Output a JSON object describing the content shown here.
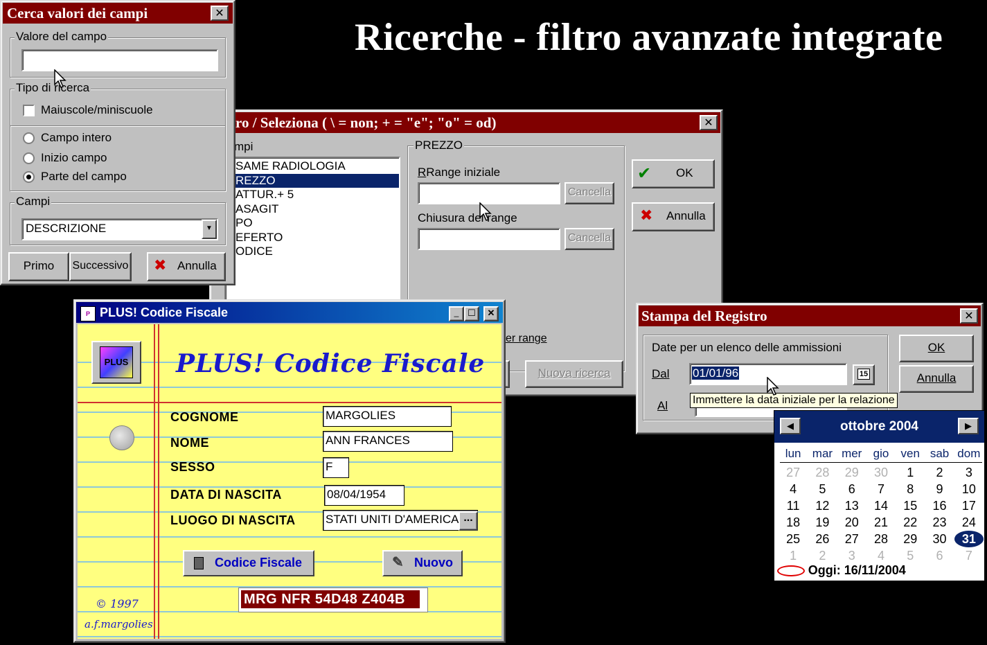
{
  "slide_title": "Ricerche - filtro avanzate integrate",
  "filtro_dialog": {
    "title": "ro / Seleziona  ( \\ = non; + = \"e\"; \"o\" = od)",
    "fields_label": "mpi",
    "fields": [
      "SAME RADIOLOGIA",
      "REZZO",
      "ATTUR.+ 5",
      "ASAGIT",
      "PO",
      "EFERTO",
      "ODICE"
    ],
    "selected_index": 1,
    "group_label": "PREZZO",
    "range_start_label": "Range iniziale",
    "range_end_label": "Chiusura del range",
    "cancel_label": "Cancella",
    "ok_label": "OK",
    "annulla_label": "Annulla",
    "tab_label": "er range",
    "new_search_label": "Nuova ricerca"
  },
  "cerca_dialog": {
    "title": "Cerca valori dei campi",
    "value_group": "Valore del campo",
    "value": "",
    "search_type_group": "Tipo di ricerca",
    "case_label": "Maiuscole/miniscuole",
    "radios": [
      "Campo intero",
      "Inizio campo",
      "Parte del campo"
    ],
    "selected_radio": 2,
    "fields_group": "Campi",
    "fields_value": "DESCRIZIONE",
    "first_label": "Primo",
    "next_label": "Successivo",
    "cancel_label": "Annulla"
  },
  "plus_window": {
    "title": "PLUS! Codice Fiscale",
    "heading": "PLUS! Codice Fiscale",
    "logo_text": "PLUS",
    "labels": {
      "cognome": "COGNOME",
      "nome": "NOME",
      "sesso": "SESSO",
      "data": "DATA DI NASCITA",
      "luogo": "LUOGO DI NASCITA"
    },
    "values": {
      "cognome": "MARGOLIES",
      "nome": "ANN FRANCES",
      "sesso": "F",
      "data": "08/04/1954",
      "luogo": "STATI UNITI D'AMERICA"
    },
    "ellipsis": "...",
    "codice_button": "Codice Fiscale",
    "nuovo_button": "Nuovo",
    "result": "MRG NFR 54D48 Z404B",
    "copyright": "© 1997",
    "author": "a.f.margolies"
  },
  "stampa_dialog": {
    "title": "Stampa del Registro",
    "group_label": "Date per un elenco delle ammissioni",
    "from_label": "Dal",
    "from_value": "01/01/96",
    "to_label": "Al",
    "calendar_button": "15",
    "tooltip": "Immettere la data iniziale per la relazione",
    "ok_label": "OK",
    "cancel_label": "Annulla"
  },
  "calendar": {
    "month": "ottobre 2004",
    "weekdays": [
      "lun",
      "mar",
      "mer",
      "gio",
      "ven",
      "sab",
      "dom"
    ],
    "weeks": [
      [
        "27",
        "28",
        "29",
        "30",
        "1",
        "2",
        "3"
      ],
      [
        "4",
        "5",
        "6",
        "7",
        "8",
        "9",
        "10"
      ],
      [
        "11",
        "12",
        "13",
        "14",
        "15",
        "16",
        "17"
      ],
      [
        "18",
        "19",
        "20",
        "21",
        "22",
        "23",
        "24"
      ],
      [
        "25",
        "26",
        "27",
        "28",
        "29",
        "30",
        "31"
      ],
      [
        "1",
        "2",
        "3",
        "4",
        "5",
        "6",
        "7"
      ]
    ],
    "selected_day": "31",
    "today_label": "Oggi: 16/11/2004",
    "selection_color": "#0a246a"
  },
  "colors": {
    "dialog_title": "#800000",
    "active_title": "#0a246a",
    "plus_background": "#ffff80",
    "plus_heading": "#1a1acc"
  }
}
